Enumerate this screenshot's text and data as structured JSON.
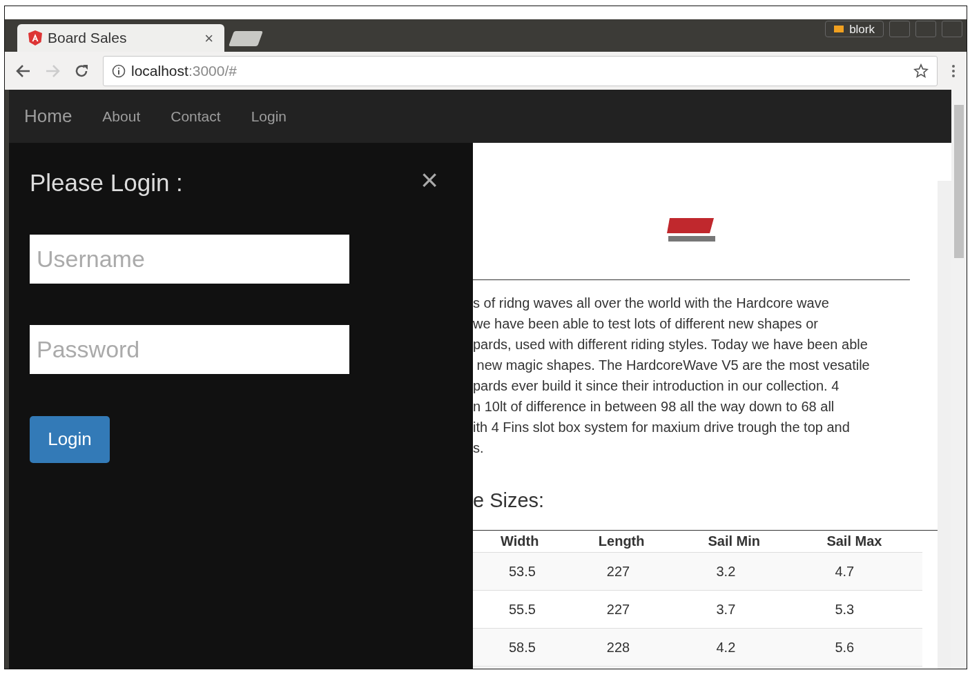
{
  "window": {
    "user": "blork"
  },
  "tab": {
    "title": "Board Sales",
    "close": "×"
  },
  "address": {
    "host": "localhost",
    "path": ":3000/#"
  },
  "navbar": {
    "brand": "Home",
    "links": [
      "About",
      "Contact",
      "Login"
    ]
  },
  "login_panel": {
    "title": "Please Login :",
    "close": "×",
    "username": {
      "placeholder": "Username"
    },
    "password": {
      "placeholder": "Password"
    },
    "button": "Login"
  },
  "content": {
    "paragraph": [
      "s of ridng waves all over the world with the Hardcore wave",
      "we have been able to test lots of different new shapes or",
      "pards, used with different riding styles. Today we have been able",
      " new magic shapes. The HardcoreWave V5 are the most vesatile",
      "pards ever build it since their introduction in our collection. 4",
      "n 10lt of difference in between 98 all the way down to 68 all",
      "ith 4 Fins slot box system for maxium drive trough the top and",
      "s."
    ],
    "heading": "e Sizes:",
    "table": {
      "columns": [
        "Width",
        "Length",
        "Sail Min",
        "Sail Max"
      ],
      "rows": [
        [
          "53.5",
          "227",
          "3.2",
          "4.7"
        ],
        [
          "55.5",
          "227",
          "3.7",
          "5.3"
        ],
        [
          "58.5",
          "228",
          "4.2",
          "5.6"
        ]
      ]
    }
  }
}
